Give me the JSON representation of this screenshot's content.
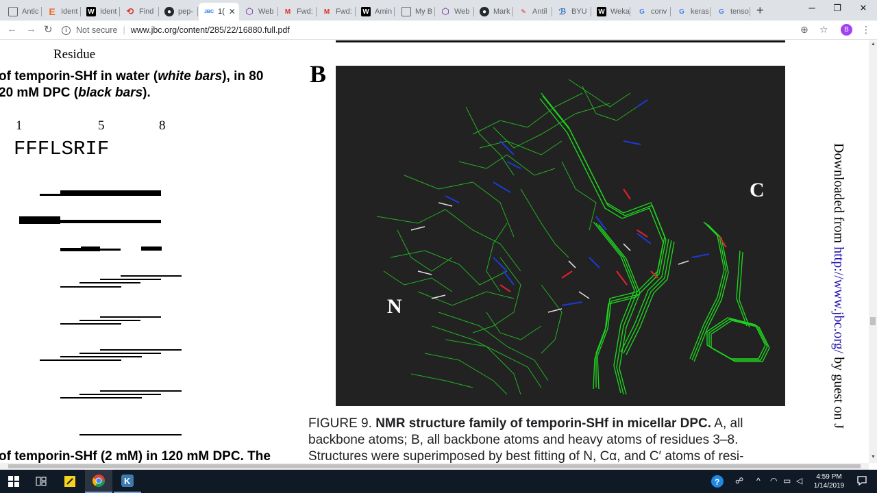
{
  "browser": {
    "tabs": [
      {
        "label": "Antic",
        "icon": "page-icon"
      },
      {
        "label": "Ident",
        "icon": "etsy-e-icon"
      },
      {
        "label": "Ident",
        "icon": "wiki-w-icon"
      },
      {
        "label": "Find",
        "icon": "swirl-icon"
      },
      {
        "label": "pep-",
        "icon": "github-icon"
      },
      {
        "label": "1(",
        "icon": "jbc-icon",
        "active": true,
        "favicon_text": "JBC"
      },
      {
        "label": "Web",
        "icon": "web-hex-icon"
      },
      {
        "label": "Fwd:",
        "icon": "gmail-icon"
      },
      {
        "label": "Fwd:",
        "icon": "gmail-icon"
      },
      {
        "label": "Amin",
        "icon": "wiki-w-icon"
      },
      {
        "label": "My B",
        "icon": "page-icon"
      },
      {
        "label": "Web",
        "icon": "web-hex-icon"
      },
      {
        "label": "Mark",
        "icon": "github-icon"
      },
      {
        "label": "Antil",
        "icon": "image-icon"
      },
      {
        "label": "BYU",
        "icon": "byu-icon"
      },
      {
        "label": "Weka",
        "icon": "wiki-w-icon"
      },
      {
        "label": "conv",
        "icon": "google-g-icon"
      },
      {
        "label": "keras",
        "icon": "google-g-icon"
      },
      {
        "label": "tenso",
        "icon": "google-g-icon"
      }
    ],
    "new_tab": "+",
    "window_controls": {
      "minimize": "─",
      "maximize": "❐",
      "close": "✕"
    },
    "security_label": "Not secure",
    "url": "www.jbc.org/content/285/22/16880.full.pdf",
    "avatar_letter": "B",
    "colors": {
      "tabstrip": "#dee1e6",
      "avatar": "#a142f4"
    }
  },
  "pdf": {
    "residue_label": "Residue",
    "left_caption_1": [
      "of temporin-SHf in water (",
      "white bars",
      "), in 80"
    ],
    "left_caption_2": [
      "20 mM DPC (",
      "black bars",
      ")."
    ],
    "residue_numbers": [
      "1",
      "5",
      "8"
    ],
    "sequence": "FFFLSRIF",
    "left_bottom_text": "of temporin-SHf (2 mM) in 120 mM DPC. The",
    "figure_letter": "B",
    "n_terminus": "N",
    "c_terminus": "C",
    "figure_caption": {
      "prefix": "FIGURE 9. ",
      "title": "NMR structure family of temporin-SHf in micellar DPC.",
      "line1_rest": " A, all",
      "line2": "backbone atoms; B, all backbone atoms and heavy atoms of residues 3–8.",
      "line3": "Structures were superimposed by best fitting of N, Cα, and C′ atoms of resi-"
    },
    "sidebar_prefix": "Downloaded from ",
    "sidebar_link": "http://www.jbc.org/",
    "sidebar_suffix": " by guest on J"
  },
  "taskbar": {
    "apps": [
      "windows-start-icon",
      "task-view-icon",
      "sticky-notes-icon",
      "chrome-icon",
      "krita-icon"
    ],
    "clock_time": "4:59 PM",
    "clock_date": "1/14/2019"
  }
}
